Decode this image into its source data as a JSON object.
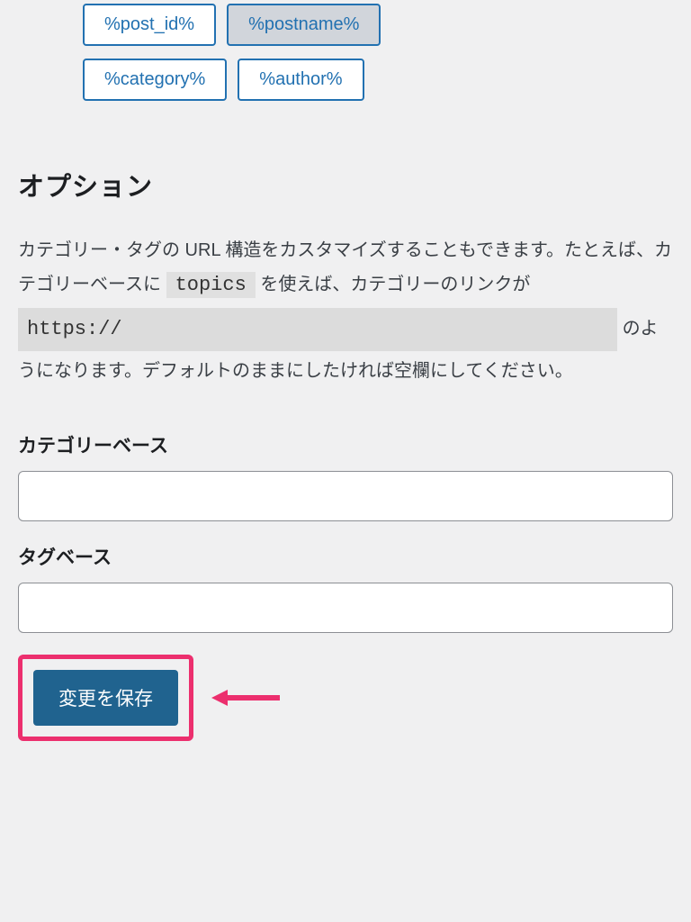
{
  "permalink_tags": {
    "row1": [
      {
        "label": "%post_id%",
        "active": false
      },
      {
        "label": "%postname%",
        "active": true
      }
    ],
    "row2": [
      {
        "label": "%category%",
        "active": false
      },
      {
        "label": "%author%",
        "active": false
      }
    ]
  },
  "options": {
    "heading": "オプション",
    "desc_part1": "カテゴリー・タグの URL 構造をカスタマイズすることもできます。たとえば、カテゴリーベースに ",
    "desc_code": "topics",
    "desc_part2": " を使えば、カテゴリーのリンクが ",
    "desc_url": "https://",
    "desc_part3": " のようになります。デフォルトのままにしたければ空欄にしてください。"
  },
  "fields": {
    "category_base": {
      "label": "カテゴリーベース",
      "value": ""
    },
    "tag_base": {
      "label": "タグベース",
      "value": ""
    }
  },
  "submit": {
    "label": "変更を保存"
  },
  "colors": {
    "highlight": "#ec2f6e",
    "primary": "#2271b1"
  }
}
